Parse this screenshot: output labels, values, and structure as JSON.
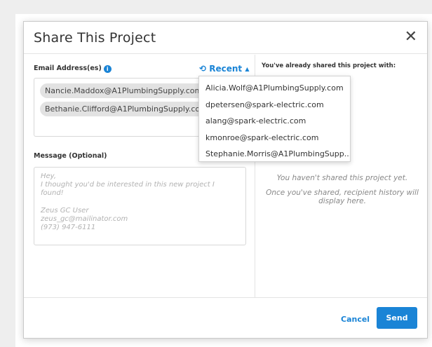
{
  "modal": {
    "title": "Share This Project",
    "close_glyph": "✕",
    "email_label": "Email Address(es)",
    "info_glyph": "i",
    "recent": {
      "icon_glyph": "⟲",
      "label": "Recent",
      "caret_glyph": "▲"
    },
    "emails": [
      "Nancie.Maddox@A1PlumbingSupply.com",
      "Bethanie.Clifford@A1PlumbingSupply.com"
    ],
    "message_label": "Message (Optional)",
    "message_text": "Hey,\nI thought you'd be interested in this new project I found!\n\nZeus GC User\nzeus_gc@mailinator.com\n(973) 947-6111",
    "shared_label": "You've already shared this project with:",
    "empty_line1": "You haven't shared this project yet.",
    "empty_line2": "Once you've shared, recipient history will display here.",
    "cancel_label": "Cancel",
    "send_label": "Send"
  },
  "recent_dropdown": {
    "items": [
      "Alicia.Wolf@A1PlumbingSupply.com",
      "dpetersen@spark-electric.com",
      "alang@spark-electric.com",
      "kmonroe@spark-electric.com",
      "Stephanie.Morris@A1PlumbingSupp..."
    ]
  },
  "colors": {
    "accent": "#1a84d6",
    "chip_bg": "#e2e2e2",
    "border": "#d8d8d8"
  }
}
